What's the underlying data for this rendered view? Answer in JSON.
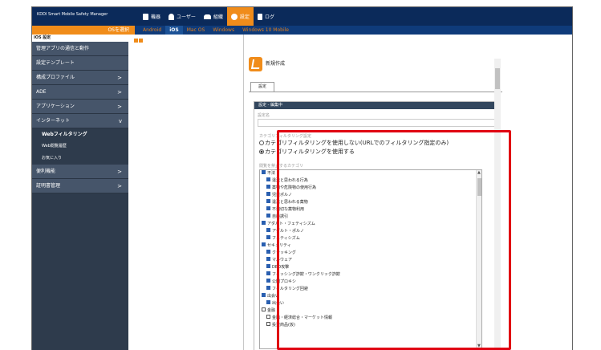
{
  "header": {
    "brand": "KDDI Smart Mobile Safety Manager",
    "nav": [
      {
        "label": "機器",
        "icon": "device-icon",
        "active": false
      },
      {
        "label": "ユーザー",
        "icon": "user-icon",
        "active": false
      },
      {
        "label": "組織",
        "icon": "organization-icon",
        "active": false
      },
      {
        "label": "設定",
        "icon": "gear-icon",
        "active": true
      },
      {
        "label": "ログ",
        "icon": "log-icon",
        "active": false
      }
    ]
  },
  "osbar": {
    "select_label": "OSを選択",
    "tabs": [
      {
        "label": "Android",
        "active": false
      },
      {
        "label": "iOS",
        "active": true
      },
      {
        "label": "Mac OS",
        "active": false
      },
      {
        "label": "Windows",
        "active": false
      },
      {
        "label": "Windows 10 Mobile",
        "active": false
      }
    ]
  },
  "sidebar": {
    "header": "iOS 設定",
    "items": [
      {
        "label": "管理アプリの通信と動作",
        "chevron": ""
      },
      {
        "label": "設定テンプレート",
        "chevron": ""
      },
      {
        "label": "構成プロファイル",
        "chevron": ">"
      },
      {
        "label": "ADE",
        "chevron": ">"
      },
      {
        "label": "アプリケーション",
        "chevron": ">"
      },
      {
        "label": "インターネット",
        "chevron": "v"
      }
    ],
    "sub_items": [
      {
        "label": "Webフィルタリング",
        "active": true
      },
      {
        "label": "Web閲覧履歴",
        "active": false
      },
      {
        "label": "お気に入り",
        "active": false
      }
    ],
    "items_after": [
      {
        "label": "便利機能",
        "chevron": ">"
      },
      {
        "label": "証明書管理",
        "chevron": ">"
      }
    ]
  },
  "main": {
    "new_create": "新規作成",
    "tab_label": "設定",
    "panel_title": "設定 - 編集中",
    "name_label": "設定名",
    "filter_label": "カテゴリフィルタリング設定",
    "radio_off": "カテゴリフィルタリングを使用しない(URLでのフィルタリング指定のみ)",
    "radio_on": "カテゴリフィルタリングを使用する",
    "category_label": "閲覧を禁止するカテゴリ",
    "categories": [
      {
        "label": "不法",
        "checked": true,
        "child": false
      },
      {
        "label": "違法と思われる行為",
        "checked": true,
        "child": true
      },
      {
        "label": "薬物や危険物の使用行為",
        "checked": true,
        "child": true
      },
      {
        "label": "児童ポルノ",
        "checked": true,
        "child": true
      },
      {
        "label": "違法と思われる薬物",
        "checked": true,
        "child": true
      },
      {
        "label": "不適切な薬物利用",
        "checked": true,
        "child": true
      },
      {
        "label": "自殺誘引",
        "checked": true,
        "child": true
      },
      {
        "label": "アダルト・フェティシズム",
        "checked": true,
        "child": false
      },
      {
        "label": "アダルト・ポルノ",
        "checked": true,
        "child": true
      },
      {
        "label": "フェティシズム",
        "checked": true,
        "child": true
      },
      {
        "label": "セキュリティ",
        "checked": true,
        "child": false
      },
      {
        "label": "クラッキング",
        "checked": true,
        "child": true
      },
      {
        "label": "マルウェア",
        "checked": true,
        "child": true
      },
      {
        "label": "DBD攻撃",
        "checked": true,
        "child": true
      },
      {
        "label": "フィッシング詐欺・ワンクリック詐欺",
        "checked": true,
        "child": true
      },
      {
        "label": "公開プロキシ",
        "checked": true,
        "child": true
      },
      {
        "label": "フィルタリング回避",
        "checked": true,
        "child": true
      },
      {
        "label": "出会い",
        "checked": true,
        "child": false
      },
      {
        "label": "出会い",
        "checked": true,
        "child": true
      },
      {
        "label": "金融",
        "checked": false,
        "child": false
      },
      {
        "label": "金融・経済総合・マーケット情報",
        "checked": false,
        "child": true
      },
      {
        "label": "投資商品(仮)",
        "checked": false,
        "child": true
      }
    ]
  }
}
